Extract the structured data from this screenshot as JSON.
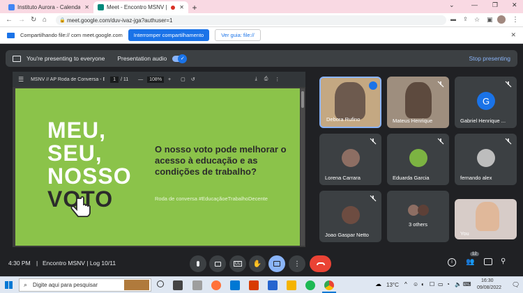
{
  "browser": {
    "tabs": [
      {
        "label": "Instituto Aurora - Calendar - We",
        "active": false
      },
      {
        "label": "Meet - Encontro MSNV | Log",
        "active": true
      }
    ],
    "url": "meet.google.com/duv-ivaz-jga?authuser=1"
  },
  "sharebar": {
    "message": "Compartilhando file:// com meet.google.com",
    "stop_label": "Interromper compartilhamento",
    "view_label": "Ver guia: file://"
  },
  "presenting": {
    "status": "You're presenting to everyone",
    "audio_label": "Presentation audio",
    "stop_label": "Stop presenting"
  },
  "pdf": {
    "title": "MSNV // AP Roda de Conversa - Educaç...",
    "page": "1",
    "total": "/ 11",
    "zoom": "108%"
  },
  "slide": {
    "word1": "MEU,",
    "word2": "SEU,",
    "word3": "NOSSO",
    "word4": "VOTO",
    "headline": "O nosso voto pode melhorar o acesso à educação e as condições de trabalho?",
    "hashtag": "Roda de conversa #EducaçãoeTrabalhoDecente"
  },
  "participants": [
    {
      "name": "Debora Rufino"
    },
    {
      "name": "Mateus Henrique"
    },
    {
      "name": "Gabriel Henrique ...",
      "initial": "G"
    },
    {
      "name": "Lorena Carrara"
    },
    {
      "name": "Eduarda Garcia"
    },
    {
      "name": "fernando alex"
    },
    {
      "name": "Joao Gaspar Netto"
    },
    {
      "name": "3 others"
    },
    {
      "name": "You"
    }
  ],
  "meeting": {
    "time": "4:30 PM",
    "title": "Encontro MSNV | Log 10/11",
    "people_count": "12"
  },
  "taskbar": {
    "search_placeholder": "Digite aqui para pesquisar",
    "weather": "13°C",
    "clock_time": "16:30",
    "clock_date": "09/08/2022"
  },
  "colors": {
    "accent": "#1a73e8",
    "slide_green": "#8bc34a",
    "end_call": "#ea4335",
    "present_active": "#8ab4f8"
  }
}
